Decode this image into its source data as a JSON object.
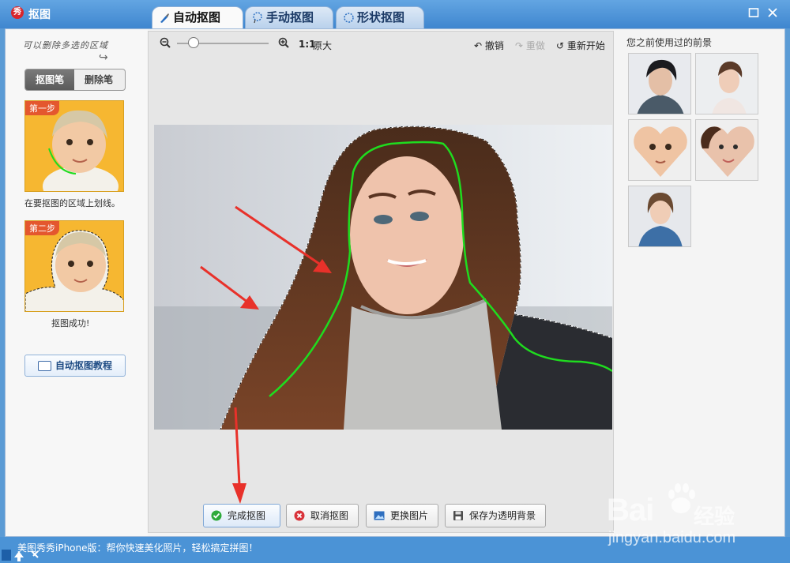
{
  "window": {
    "title": "抠图",
    "app_icon_text": "秀"
  },
  "tabs": [
    {
      "label": "自动抠图",
      "active": true
    },
    {
      "label": "手动抠图",
      "active": false
    },
    {
      "label": "形状抠图",
      "active": false
    }
  ],
  "left": {
    "hint": "可以删除多选的区域",
    "modes": {
      "brush": "抠图笔",
      "eraser": "删除笔"
    },
    "step1": {
      "badge": "第一步",
      "caption": "在要抠图的区域上划线。"
    },
    "step2": {
      "badge": "第二步",
      "caption": "抠图成功!"
    },
    "tutorial_button": "自动抠图教程"
  },
  "toolbar": {
    "ratio": "1:1",
    "ratio_label": "原大",
    "undo": "撤销",
    "redo": "重做",
    "restart": "重新开始"
  },
  "buttons": {
    "done": "完成抠图",
    "cancel": "取消抠图",
    "replace": "更换图片",
    "save_transparent": "保存为透明背景"
  },
  "right": {
    "title": "您之前使用过的前景"
  },
  "status": {
    "text": "美图秀秀iPhone版：帮你快速美化照片，轻松搞定拼图！"
  },
  "watermark": {
    "brand": "Bai",
    "suffix": "经验",
    "url": "jingyan.baidu.com"
  },
  "colors": {
    "title_bar": "#4a90d9",
    "stroke_green": "#1fdc1f",
    "arrow_red": "#e8312a"
  }
}
